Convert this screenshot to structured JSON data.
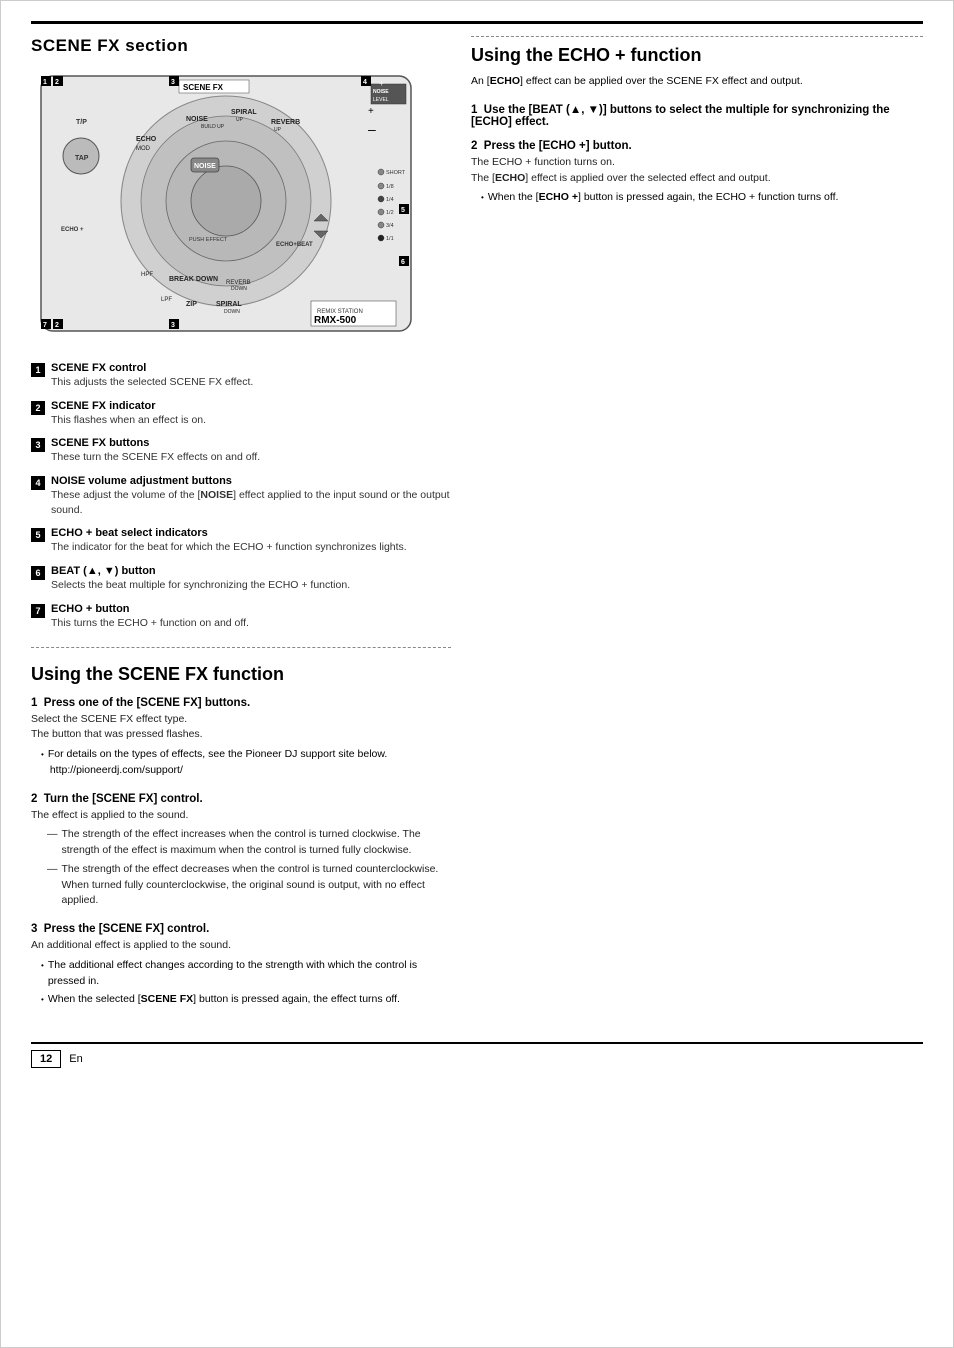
{
  "page": {
    "title": "SCENE FX section",
    "footer": {
      "page_number": "12",
      "lang": "En"
    }
  },
  "device_diagram": {
    "label": "RMX-500",
    "sublabel": "REMIX STATION",
    "callout_numbers": [
      "1",
      "2",
      "3",
      "4",
      "5",
      "6",
      "7",
      "2",
      "3"
    ]
  },
  "callouts": [
    {
      "number": "1",
      "title": "SCENE FX control",
      "desc": "This adjusts the selected SCENE FX effect."
    },
    {
      "number": "2",
      "title": "SCENE FX indicator",
      "desc": "This flashes when an effect is on."
    },
    {
      "number": "3",
      "title": "SCENE FX buttons",
      "desc": "These turn the SCENE FX effects on and off."
    },
    {
      "number": "4",
      "title": "NOISE volume adjustment buttons",
      "desc": "These adjust the volume of the [NOISE] effect applied to the input sound or the output sound."
    },
    {
      "number": "5",
      "title": "ECHO + beat select indicators",
      "desc": "The indicator for the beat for which the ECHO + function synchronizes lights."
    },
    {
      "number": "6",
      "title": "BEAT (▲, ▼) button",
      "desc": "Selects the beat multiple for synchronizing the ECHO + function."
    },
    {
      "number": "7",
      "title": "ECHO + button",
      "desc": "This turns the ECHO + function on and off."
    }
  ],
  "scene_fx_section": {
    "heading": "Using the SCENE FX function",
    "steps": [
      {
        "number": "1",
        "title": "Press one of the [SCENE FX] buttons.",
        "lines": [
          "Select the SCENE FX effect type.",
          "The button that was pressed flashes."
        ],
        "bullets": [
          {
            "text": "For details on the types of effects, see the Pioneer DJ support site below.",
            "sub": "http://pioneerdj.com/support/"
          }
        ]
      },
      {
        "number": "2",
        "title": "Turn the [SCENE FX] control.",
        "lines": [
          "The effect is applied to the sound."
        ],
        "dashes": [
          "The strength of the effect increases when the control is turned clockwise. The strength of the effect is maximum when the control is turned fully clockwise.",
          "The strength of the effect decreases when the control is turned counterclockwise. When turned fully counterclockwise, the original sound is output, with no effect applied."
        ]
      },
      {
        "number": "3",
        "title": "Press the [SCENE FX] control.",
        "lines": [
          "An additional effect is applied to the sound."
        ],
        "bullets": [
          {
            "text": "The additional effect changes according to the strength with which the control is pressed in."
          },
          {
            "text": "When the selected [SCENE FX] button is pressed again, the effect turns off.",
            "bold_part": "SCENE FX"
          }
        ]
      }
    ]
  },
  "echo_section": {
    "heading": "Using the ECHO + function",
    "intro": "An [ECHO] effect can be applied over the SCENE FX effect and output.",
    "steps": [
      {
        "number": "1",
        "title": "Use the [BEAT (▲, ▼)] buttons to select the multiple for synchronizing the [ECHO] effect."
      },
      {
        "number": "2",
        "title": "Press the [ECHO +] button.",
        "lines": [
          "The ECHO + function turns on.",
          "The [ECHO] effect is applied over the selected effect and output."
        ],
        "bullets": [
          "When the [ECHO +] button is pressed again, the ECHO + function turns off."
        ]
      }
    ]
  }
}
